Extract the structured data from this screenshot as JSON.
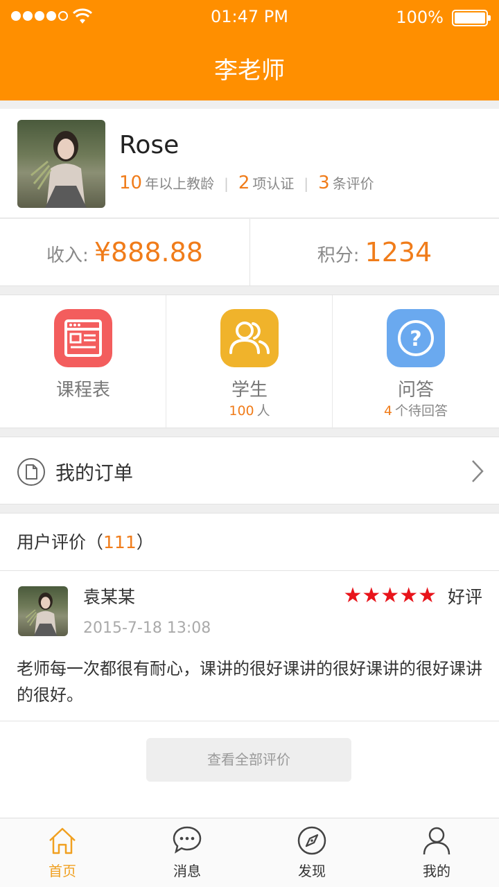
{
  "status_bar": {
    "time": "01:47 PM",
    "battery": "100%"
  },
  "header": {
    "title": "李老师"
  },
  "profile": {
    "name": "Rose",
    "stats": [
      {
        "num": "10",
        "label": "年以上教龄"
      },
      {
        "num": "2",
        "label": "项认证"
      },
      {
        "num": "3",
        "label": "条评价"
      }
    ]
  },
  "money": {
    "income_label": "收入:",
    "income_value": "¥888.88",
    "points_label": "积分:",
    "points_value": "1234"
  },
  "features": {
    "schedule": {
      "label": "课程表",
      "icon": "schedule-icon",
      "color": "#f35d5d"
    },
    "students": {
      "label": "学生",
      "sub_num": "100",
      "sub_text": "人",
      "icon": "students-icon",
      "color": "#f0b32b"
    },
    "qa": {
      "label": "问答",
      "sub_num": "4",
      "sub_text": "个待回答",
      "icon": "question-icon",
      "color": "#6aa9ef"
    }
  },
  "orders": {
    "label": "我的订单"
  },
  "reviews": {
    "title_prefix": "用户评价（",
    "count": "111",
    "title_suffix": "）",
    "items": [
      {
        "name": "袁某某",
        "date": "2015-7-18   13:08",
        "stars": "★★★★★",
        "rating": "好评",
        "text": "老师每一次都很有耐心，课讲的很好课讲的很好课讲的很好课讲的很好。"
      }
    ],
    "view_all": "查看全部评价"
  },
  "tabbar": {
    "items": [
      {
        "label": "首页",
        "icon": "home-icon"
      },
      {
        "label": "消息",
        "icon": "message-icon"
      },
      {
        "label": "发现",
        "icon": "compass-icon"
      },
      {
        "label": "我的",
        "icon": "user-icon"
      }
    ],
    "active_color": "#f0a020"
  },
  "colors": {
    "brand": "#ff8f00",
    "accent": "#f07c1a"
  }
}
